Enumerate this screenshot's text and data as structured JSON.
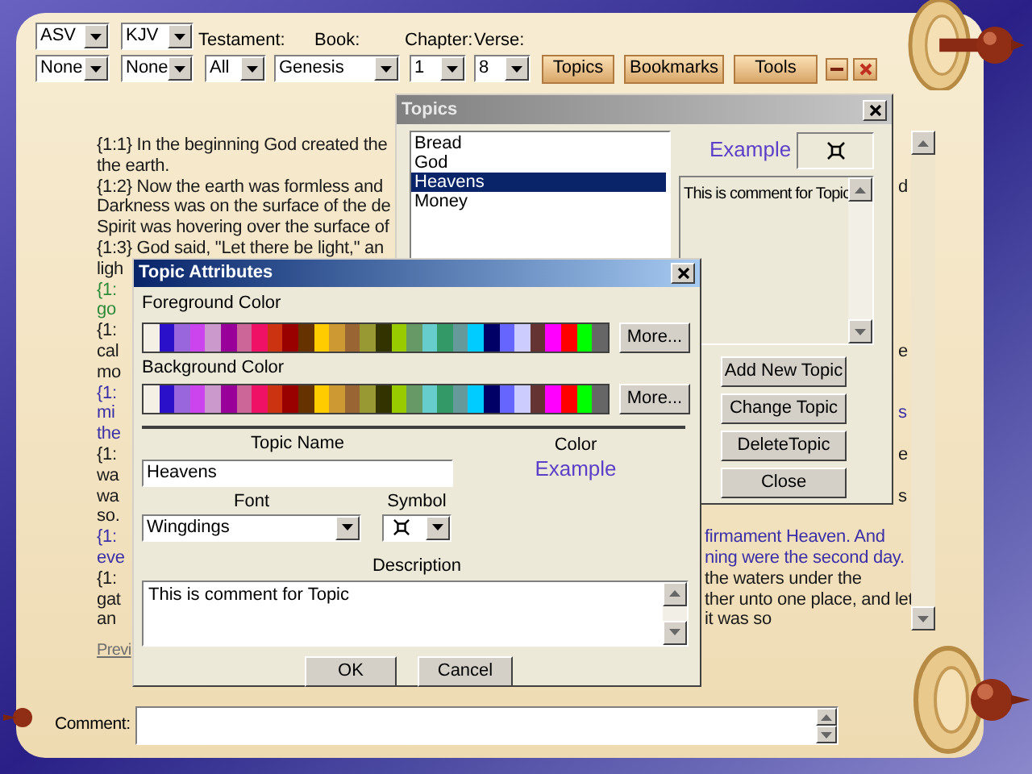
{
  "toolbar": {
    "top_dropdowns": [
      {
        "value": "ASV"
      },
      {
        "value": "KJV"
      }
    ],
    "labels": [
      "Testament:",
      "Book:",
      "Chapter:",
      "Verse:"
    ],
    "dropdowns": [
      {
        "value": "None"
      },
      {
        "value": "None"
      },
      {
        "value": "All"
      },
      {
        "value": "Genesis"
      },
      {
        "value": "1"
      },
      {
        "value": "8"
      }
    ],
    "buttons": [
      "Topics",
      "Bookmarks",
      "Tools"
    ]
  },
  "scripture": {
    "lines": [
      {
        "text": "{1:1} In the beginning God created the",
        "color": "#1a1a1a"
      },
      {
        "text": "the earth.",
        "color": "#1a1a1a"
      },
      {
        "text": "{1:2} Now the earth was formless and",
        "color": "#1a1a1a",
        "edge": "d"
      },
      {
        "text": "Darkness was on the surface of the de",
        "color": "#1a1a1a"
      },
      {
        "text": "Spirit was hovering over the surface of",
        "color": "#1a1a1a"
      },
      {
        "text": "{1:3} God said, \"Let there be light,\" an",
        "color": "#1a1a1a"
      },
      {
        "text": "ligh",
        "color": "#1a1a1a"
      },
      {
        "text": "{1:",
        "color": "#2e8b3a"
      },
      {
        "text": "go",
        "color": "#2e8b3a"
      },
      {
        "text": "{1:",
        "color": "#1a1a1a"
      },
      {
        "text": "cal",
        "color": "#1a1a1a",
        "edge": "e"
      },
      {
        "text": "mo",
        "color": "#1a1a1a"
      },
      {
        "text": "{1:",
        "color": "#3b2fa8"
      },
      {
        "text": "mi",
        "color": "#3b2fa8",
        "edge": "s"
      },
      {
        "text": "the",
        "color": "#3b2fa8"
      },
      {
        "text": "{1:",
        "color": "#1a1a1a",
        "edge": "e"
      },
      {
        "text": "wa",
        "color": "#1a1a1a"
      },
      {
        "text": "wa",
        "color": "#1a1a1a",
        "edge": "s"
      },
      {
        "text": "so.",
        "color": "#1a1a1a"
      },
      {
        "text": "{1:",
        "color": "#3b2fa8",
        "tail": "firmament Heaven. And"
      },
      {
        "text": "eve",
        "color": "#3b2fa8",
        "tail": "ning were the second day."
      },
      {
        "text": "{1:",
        "color": "#1a1a1a",
        "tail": "the waters under the"
      },
      {
        "text": "gat",
        "color": "#1a1a1a",
        "tail": "ther unto one place, and let"
      },
      {
        "text": "an",
        "color": "#1a1a1a",
        "tail": "it was so"
      }
    ],
    "link": "Previ"
  },
  "comment": {
    "label": "Comment:"
  },
  "topics_window": {
    "title": "Topics",
    "active": false,
    "topics": [
      {
        "label": "Bread",
        "selected": false
      },
      {
        "label": "God",
        "selected": false
      },
      {
        "label": "Heavens",
        "selected": true
      },
      {
        "label": "Money",
        "selected": false
      }
    ],
    "example": "Example",
    "comment": "This is comment for Topic",
    "buttons": [
      "Add New Topic",
      "Change Topic",
      "DeleteTopic",
      "Close"
    ]
  },
  "attributes_window": {
    "title": "Topic Attributes",
    "active": true,
    "palettes": [
      {
        "label": "Foreground Color",
        "button": "More...",
        "swatches": [
          {
            "color": "#f5f0e6"
          },
          {
            "color": "#2a10c8"
          },
          {
            "color": "#9966dd"
          },
          {
            "color": "#cc44ee"
          },
          {
            "color": "#cc99cc"
          },
          {
            "color": "#990099"
          },
          {
            "color": "#cc6699"
          },
          {
            "color": "#ee1166"
          },
          {
            "color": "#cc3311"
          },
          {
            "color": "#990000"
          },
          {
            "color": "#663300"
          },
          {
            "color": "#ffcc00"
          },
          {
            "color": "#cc9933"
          },
          {
            "color": "#996633"
          },
          {
            "color": "#999933"
          },
          {
            "color": "#333300"
          },
          {
            "color": "#99cc00"
          },
          {
            "color": "#669966"
          },
          {
            "color": "#66cccc"
          },
          {
            "color": "#339966"
          },
          {
            "color": "#669999"
          },
          {
            "color": "#00ccff"
          },
          {
            "color": "#000066"
          },
          {
            "color": "#6666ff"
          },
          {
            "color": "#ccccff"
          },
          {
            "color": "#663333"
          },
          {
            "color": "#ff00ff"
          },
          {
            "color": "#ff0000"
          },
          {
            "color": "#00ff00"
          },
          {
            "color": "#666666"
          }
        ]
      },
      {
        "label": "Background Color",
        "button": "More...",
        "swatches": [
          {
            "color": "#f5f0e6"
          },
          {
            "color": "#2a10c8"
          },
          {
            "color": "#9966dd"
          },
          {
            "color": "#cc44ee"
          },
          {
            "color": "#cc99cc"
          },
          {
            "color": "#990099"
          },
          {
            "color": "#cc6699"
          },
          {
            "color": "#ee1166"
          },
          {
            "color": "#cc3311"
          },
          {
            "color": "#990000"
          },
          {
            "color": "#663300"
          },
          {
            "color": "#ffcc00"
          },
          {
            "color": "#cc9933"
          },
          {
            "color": "#996633"
          },
          {
            "color": "#999933"
          },
          {
            "color": "#333300"
          },
          {
            "color": "#99cc00"
          },
          {
            "color": "#669966"
          },
          {
            "color": "#66cccc"
          },
          {
            "color": "#339966"
          },
          {
            "color": "#669999"
          },
          {
            "color": "#00ccff"
          },
          {
            "color": "#000066"
          },
          {
            "color": "#6666ff"
          },
          {
            "color": "#ccccff"
          },
          {
            "color": "#663333"
          },
          {
            "color": "#ff00ff"
          },
          {
            "color": "#ff0000"
          },
          {
            "color": "#00ff00"
          },
          {
            "color": "#666666"
          }
        ]
      }
    ],
    "topic_name": {
      "label": "Topic Name",
      "value": "Heavens"
    },
    "color": {
      "label": "Color",
      "example": "Example"
    },
    "font": {
      "label": "Font",
      "value": "Wingdings"
    },
    "symbol": {
      "label": "Symbol"
    },
    "description": {
      "label": "Description",
      "value": "This is comment for Topic"
    },
    "buttons": [
      "OK",
      "Cancel"
    ]
  }
}
